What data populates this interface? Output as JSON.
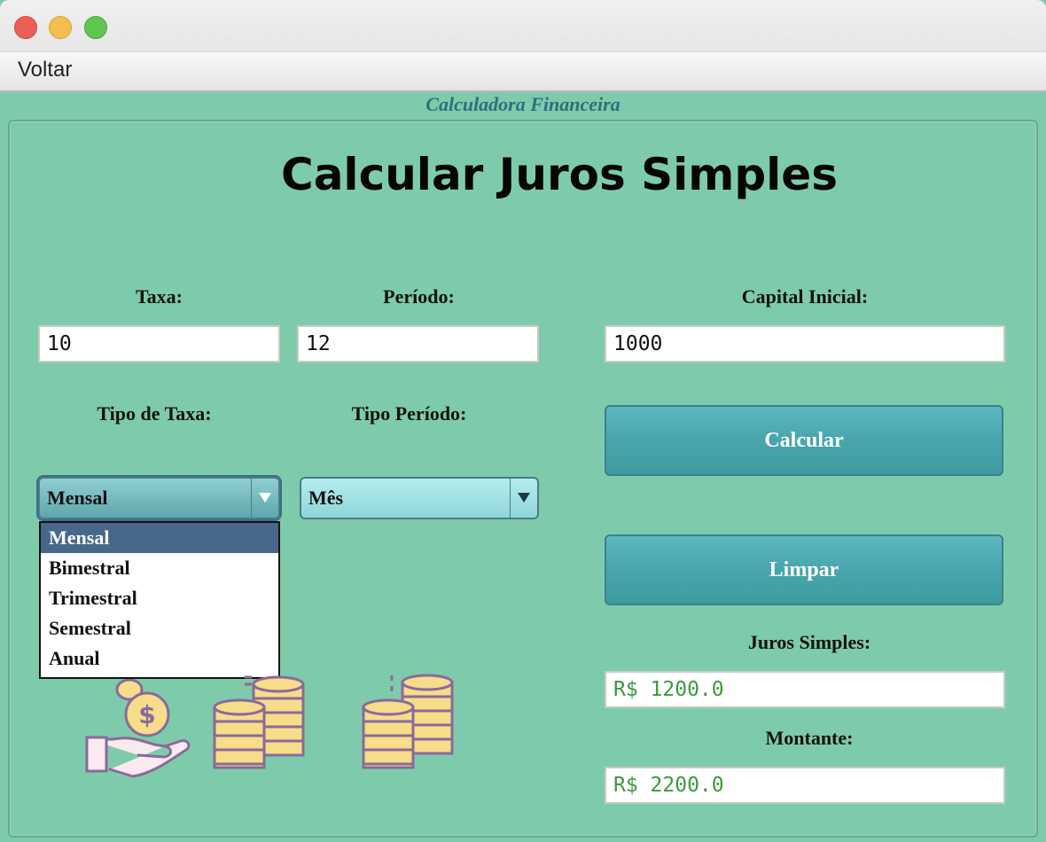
{
  "menubar": {
    "voltar_label": "Voltar"
  },
  "frame": {
    "title": "Calculadora Financeira"
  },
  "main": {
    "heading": "Calcular Juros Simples",
    "taxa": {
      "label": "Taxa:",
      "value": "10"
    },
    "periodo": {
      "label": "Período:",
      "value": "12"
    },
    "capital": {
      "label": "Capital Inicial:",
      "value": "1000"
    },
    "tipo_taxa": {
      "label": "Tipo de Taxa:",
      "selected": "Mensal",
      "options": [
        "Mensal",
        "Bimestral",
        "Trimestral",
        "Semestral",
        "Anual"
      ]
    },
    "tipo_periodo": {
      "label": "Tipo Período:",
      "selected": "Mês"
    },
    "calcular_label": "Calcular",
    "limpar_label": "Limpar",
    "juros": {
      "label": "Juros Simples:",
      "value": "R$ 1200.0"
    },
    "montante": {
      "label": "Montante:",
      "value": "R$ 2200.0"
    }
  },
  "colors": {
    "background": "#7ecbac",
    "button": "#4aa7ad",
    "dropdown_selected": "#48688b",
    "result_text": "#3a9a3a",
    "title": "#2f6e7a"
  },
  "icons": [
    "hand-coin-icon",
    "coin-stack-icon",
    "coin-stack-icon"
  ]
}
